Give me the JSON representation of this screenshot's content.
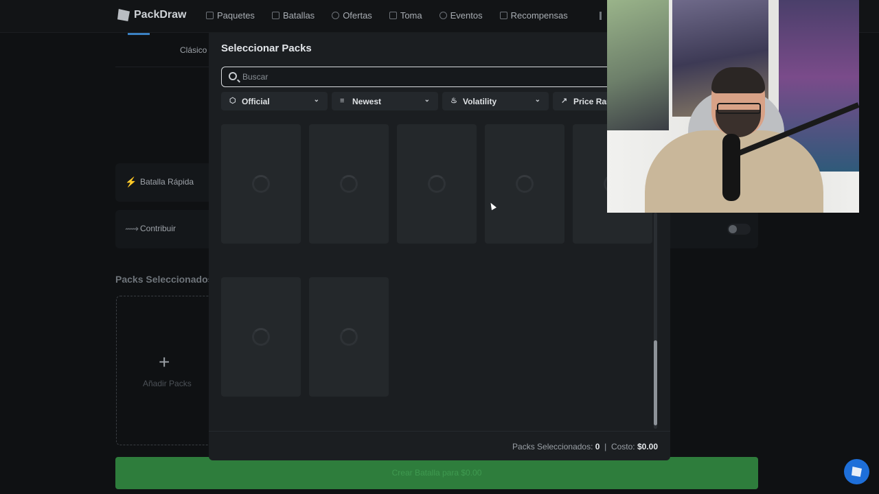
{
  "app": {
    "logo_text": "PackDraw"
  },
  "nav": {
    "items": [
      {
        "label": "Paquetes",
        "icon": "package-icon"
      },
      {
        "label": "Batallas",
        "icon": "swords-icon"
      },
      {
        "label": "Ofertas",
        "icon": "tag-icon"
      },
      {
        "label": "Toma",
        "icon": "edit-icon"
      },
      {
        "label": "Eventos",
        "icon": "flame-icon"
      },
      {
        "label": "Recompensas",
        "icon": "gift-icon"
      }
    ]
  },
  "background": {
    "mode_tab": "Clásico",
    "rows": [
      {
        "label": "Batalla Rápida",
        "icon": "lightning-icon"
      },
      {
        "label": "Contribuir",
        "icon": "handshake-icon"
      }
    ],
    "packs_selected_title": "Packs Seleccionados",
    "add_packs_label": "Añadir Packs",
    "add_packs_symbol": "+",
    "create_button": "Crear Batalla para $0.00"
  },
  "modal": {
    "title": "Seleccionar Packs",
    "search": {
      "placeholder": "Buscar",
      "value": ""
    },
    "filters": [
      {
        "label": "Official",
        "icon": "cube-icon"
      },
      {
        "label": "Newest",
        "icon": "sliders-icon"
      },
      {
        "label": "Volatility",
        "icon": "flame-icon"
      },
      {
        "label": "Price Ran",
        "icon": "trending-up-icon"
      }
    ],
    "loading_cards": 7,
    "footer": {
      "selected_label": "Packs Seleccionados:",
      "selected_count": "0",
      "separator": "|",
      "cost_label": "Costo:",
      "cost_value": "$0.00"
    }
  },
  "colors": {
    "background": "#0f1113",
    "modal": "#1b1e21",
    "card": "#24282b",
    "create_button": "#2e7d3c",
    "accent": "#3b82c4",
    "help_button": "#1e6fd9"
  }
}
